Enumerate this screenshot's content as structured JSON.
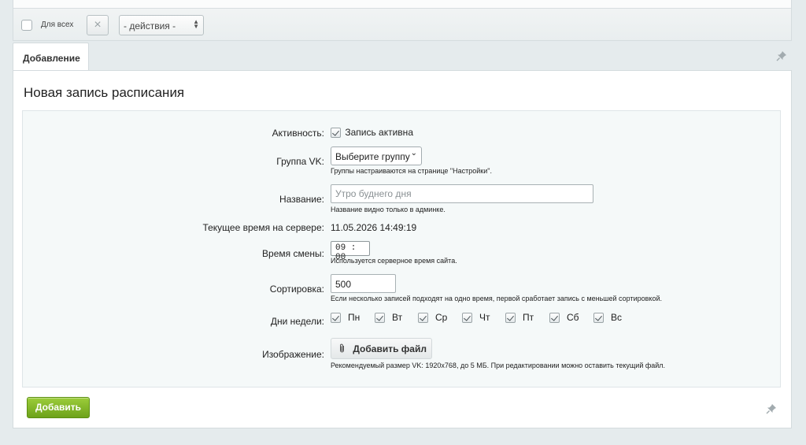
{
  "toolbar": {
    "all_label": "Для всех",
    "clear_icon": "×",
    "actions_select": "- действия -"
  },
  "tabs": [
    {
      "label": "Добавление",
      "active": true
    }
  ],
  "form": {
    "title": "Новая запись расписания",
    "active": {
      "label": "Активность:",
      "checkbox_label": "Запись активна",
      "checked": true
    },
    "group": {
      "label": "Группа VK:",
      "selected": "Выберите группу",
      "hint": "Группы настраиваются на странице \"Настройки\"."
    },
    "name": {
      "label": "Название:",
      "value": "",
      "placeholder": "Утро буднего дня",
      "hint": "Название видно только в админке."
    },
    "server_time": {
      "label": "Текущее время на сервере:",
      "value": "11.05.2026 14:49:19"
    },
    "change_time": {
      "label": "Время смены:",
      "value": "09 : 00",
      "hint": "Используется серверное время сайта."
    },
    "sort": {
      "label": "Сортировка:",
      "value": "500",
      "hint": "Если несколько записей подходят на одно время, первой сработает запись с меньшей сортировкой."
    },
    "weekdays": {
      "label": "Дни недели:",
      "days": [
        {
          "label": "Пн",
          "checked": true
        },
        {
          "label": "Вт",
          "checked": true
        },
        {
          "label": "Ср",
          "checked": true
        },
        {
          "label": "Чт",
          "checked": true
        },
        {
          "label": "Пт",
          "checked": true
        },
        {
          "label": "Сб",
          "checked": true
        },
        {
          "label": "Вс",
          "checked": true
        }
      ]
    },
    "image": {
      "label": "Изображение:",
      "button_label": "Добавить файл",
      "hint": "Рекомендуемый размер VK: 1920x768, до 5 МБ. При редактировании можно оставить текущий файл."
    },
    "submit_label": "Добавить"
  },
  "colors": {
    "accent_green": "#7fb526",
    "page_bg": "#e5ebed"
  }
}
